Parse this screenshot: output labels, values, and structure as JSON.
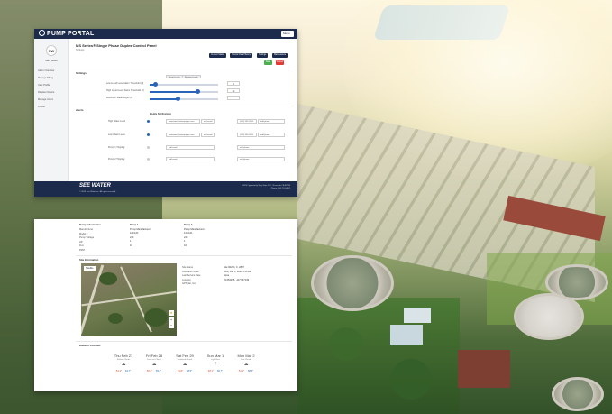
{
  "app": {
    "name": "PUMP PORTAL",
    "user_menu": "Menu"
  },
  "sidebar": {
    "initials": "SW",
    "user_name": "Sam Water",
    "items": [
      "Alarm Overview",
      "Manage Billing",
      "User Profile",
      "Register Device",
      "Manage Users",
      "Logout"
    ]
  },
  "device": {
    "title": "MS Series® Single Phase Duplex Control Panel",
    "subtitle": "Settings",
    "tabs": [
      "Current Status",
      "Historic Data/History",
      "Settings",
      "Maintenance"
    ],
    "buttons": {
      "save": "Save",
      "cancel": "Cancel"
    }
  },
  "settings": {
    "section": "Settings",
    "reset_label": "Reset Levels",
    "restore_label": "Restore Levels",
    "rows": [
      {
        "label": "Low Liquid Level Alarm Threshold (ft)",
        "value": "4",
        "level": 0.08
      },
      {
        "label": "High Liquid Level Alarm Threshold (ft)",
        "value": "12",
        "level": 0.7
      },
      {
        "label": "Maximum Water Depth (ft)",
        "value": "",
        "level": 0.42
      }
    ]
  },
  "alerts": {
    "section": "Alerts",
    "col_header": "Enable Notifications",
    "rows": [
      {
        "label": "High Water Level",
        "email": "samwater@waterpumps.com",
        "email_add": "add email",
        "phone": "(555) 555-5555",
        "phone_add": "add phone",
        "on": true
      },
      {
        "label": "Low Water Level",
        "email": "samwater@waterpumps.com",
        "email_add": "add email",
        "phone": "(555) 555-5555",
        "phone_add": "add phone",
        "on": true
      },
      {
        "label": "Pump 1 Tripping",
        "email": "add email",
        "email_add": "",
        "phone": "add phone",
        "phone_add": "",
        "on": false
      },
      {
        "label": "Pump 2 Tripping",
        "email": "add email",
        "email_add": "",
        "phone": "add phone",
        "phone_add": "",
        "on": false
      }
    ]
  },
  "footer": {
    "logo": "SEE WATER",
    "copyright": "© 2020 See Water Inc. All rights reserved.",
    "address": "20200 Opportunity Way Suite 101 · Riverside CA 92518",
    "phone": "Phone: 800-TO-SEE2"
  },
  "pump_info": {
    "title": "Pump Information",
    "keys": [
      "Manufacturer",
      "Model #",
      "Pump Voltage",
      "HP",
      "FLA",
      "RPM"
    ],
    "pump1": {
      "title": "Pump 1",
      "values": [
        "Pump Manufacturer",
        "1234-01",
        "240",
        "1",
        "10",
        ""
      ]
    },
    "pump2": {
      "title": "Pump 2",
      "values": [
        "Pump Manufacturer",
        "1234-01",
        "240",
        "1",
        "10",
        ""
      ]
    }
  },
  "site_info": {
    "title": "Site Information",
    "map_type": "Satellite",
    "keys": [
      "Site Name",
      "Installation Date",
      "Last Service Date",
      "Location",
      "GPS (lat, lon)"
    ],
    "values": [
      "Site #2234, C. 2887",
      "Wed, July 1, 2020 1:50 AM",
      "None",
      "",
      "34.052235, -117.547139"
    ]
  },
  "weather": {
    "title": "Weather Forecast",
    "days": [
      {
        "date": "Thu Feb 27",
        "cond": "Broken Clouds",
        "icon": "cloud-icon",
        "glyph": "☁",
        "lo": "51.4°",
        "hi": "64.7°"
      },
      {
        "date": "Fri Feb 28",
        "cond": "Overcast Clouds",
        "icon": "cloud-icon",
        "glyph": "☁",
        "lo": "50.1°",
        "hi": "65.2°"
      },
      {
        "date": "Sat Feb 29",
        "cond": "Scattered Clouds",
        "icon": "cloud-icon",
        "glyph": "☁",
        "lo": "51.8°",
        "hi": "68.5°"
      },
      {
        "date": "Sun Mar 1",
        "cond": "Light Rain",
        "icon": "rain-icon",
        "glyph": "☂",
        "lo": "48.1°",
        "hi": "66.7°"
      },
      {
        "date": "Mon Mar 2",
        "cond": "Few Clouds",
        "icon": "cloud-icon",
        "glyph": "☁",
        "lo": "51.6°",
        "hi": "68.5°"
      }
    ]
  },
  "colors": {
    "navy": "#1c2b4b",
    "accent": "#2a63b8",
    "save": "#4caf50",
    "cancel": "#e53935"
  }
}
